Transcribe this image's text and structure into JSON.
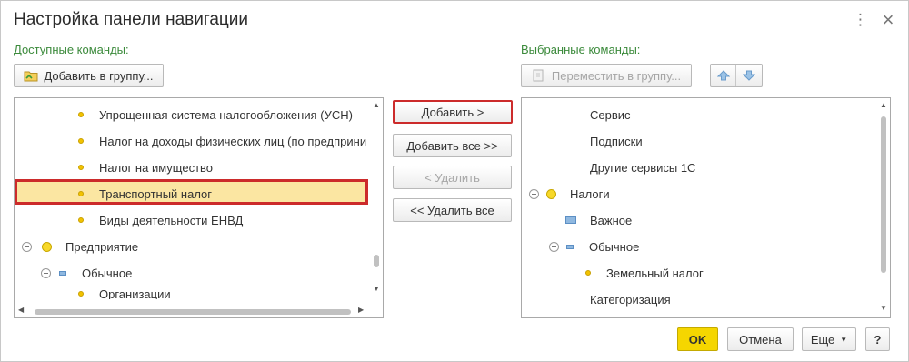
{
  "dialog": {
    "title": "Настройка панели навигации",
    "more_icon": "vertical-ellipsis-icon",
    "close_icon": "close-icon",
    "more_glyph": "⋮",
    "close_glyph": "×"
  },
  "available": {
    "label": "Доступные команды:",
    "add_to_group_label": "Добавить в группу...",
    "items": [
      {
        "label": "Упрощенная система налогообложения (УСН)",
        "icon": "dot-small"
      },
      {
        "label": "Налог на доходы физических лиц (по предприни",
        "icon": "dot-small"
      },
      {
        "label": "Налог на имущество",
        "icon": "dot-small"
      },
      {
        "label": "Транспортный налог",
        "icon": "dot-small",
        "selected": true
      },
      {
        "label": "Виды деятельности ЕНВД",
        "icon": "dot-small"
      },
      {
        "label": "Предприятие",
        "icon": "dot-big",
        "expanded": true
      },
      {
        "label": "Обычное",
        "icon": "rect-small",
        "expanded": true
      },
      {
        "label": "Организации",
        "icon": "dot-small"
      }
    ]
  },
  "middle": {
    "add_label": "Добавить >",
    "add_all_label": "Добавить все >>",
    "remove_label": "< Удалить",
    "remove_all_label": "<< Удалить все"
  },
  "selected": {
    "label": "Выбранные команды:",
    "move_to_group_label": "Переместить в группу...",
    "up_icon": "arrow-up-icon",
    "down_icon": "arrow-down-icon",
    "items": [
      {
        "label": "Сервис"
      },
      {
        "label": "Подписки"
      },
      {
        "label": "Другие сервисы 1С"
      },
      {
        "label": "Налоги",
        "icon": "dot-big",
        "expanded": true
      },
      {
        "label": "Важное",
        "icon": "rect-big"
      },
      {
        "label": "Обычное",
        "icon": "rect-small",
        "expanded": true
      },
      {
        "label": "Земельный налог",
        "icon": "dot-small"
      },
      {
        "label": "Категоризация"
      }
    ]
  },
  "footer": {
    "ok_label": "OK",
    "cancel_label": "Отмена",
    "more_label": "Еще",
    "help_label": "?"
  },
  "colors": {
    "section_label": "#3b8a3b",
    "highlight_border": "#cc2b2b",
    "selected_row": "#fbe6a2",
    "ok_button": "#f5d600"
  }
}
